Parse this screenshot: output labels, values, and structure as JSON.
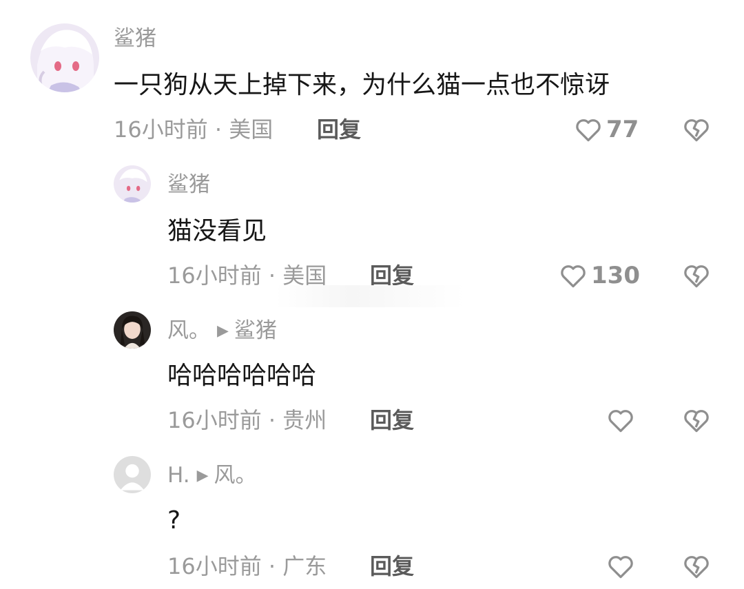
{
  "comments": [
    {
      "name": "鲨猪",
      "text": "一只狗从天上掉下来，为什么猫一点也不惊讶",
      "meta": "16小时前 · 美国",
      "reply": "回复",
      "likes": "77"
    },
    {
      "name": "鲨猪",
      "text": "猫没看见",
      "meta": "16小时前 · 美国",
      "reply": "回复",
      "likes": "130"
    },
    {
      "name": "风。",
      "reply_to": "鲨猪",
      "text": "哈哈哈哈哈哈",
      "meta": "16小时前 · 贵州",
      "reply": "回复",
      "likes": ""
    },
    {
      "name": "H.",
      "reply_to": "风。",
      "text": "?",
      "meta": "16小时前 · 广东",
      "reply": "回复",
      "likes": ""
    }
  ],
  "icons": {
    "like": "heart-outline-icon",
    "dislike": "broken-heart-icon",
    "reply_arrow": "triangle-right-icon"
  },
  "colors": {
    "secondary_text": "#9a9a9a",
    "primary_text": "#161616",
    "icon_stroke": "#8f8f8f"
  }
}
